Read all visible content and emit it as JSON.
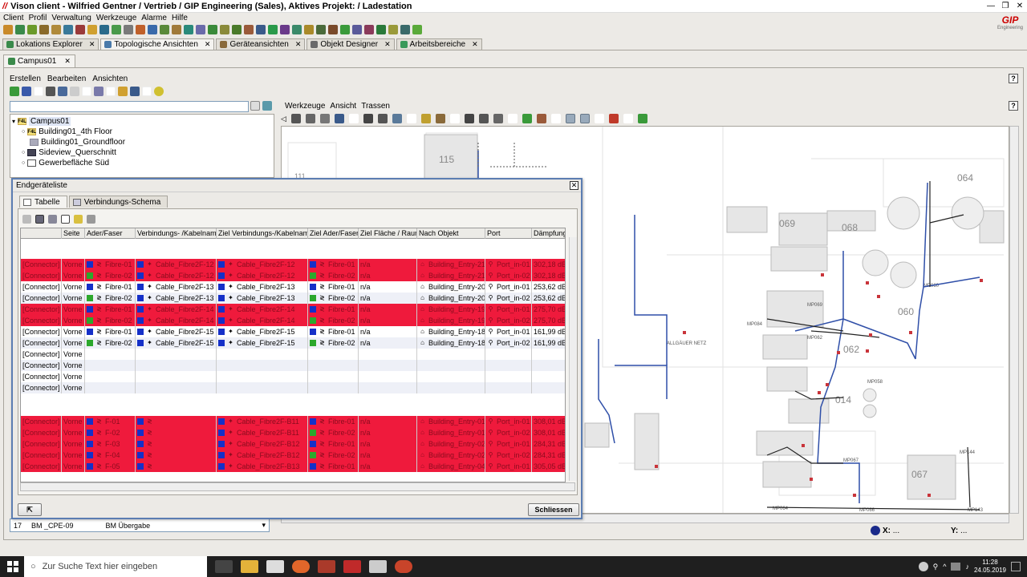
{
  "window": {
    "title": "Vison client - Wilfried Gentner / Vertrieb / GIP Engineering (Sales), Aktives Projekt: / Ladestation",
    "logo": "//",
    "brand": "GIP",
    "brand_sub": "Engineering"
  },
  "menu": [
    "Client",
    "Profil",
    "Verwaltung",
    "Werkzeuge",
    "Alarme",
    "Hilfe"
  ],
  "main_tabs": [
    {
      "label": "Lokations Explorer",
      "active": false
    },
    {
      "label": "Topologische Ansichten",
      "active": true
    },
    {
      "label": "Geräteansichten",
      "active": false
    },
    {
      "label": "Objekt Designer",
      "active": false
    },
    {
      "label": "Arbeitsbereiche",
      "active": false
    }
  ],
  "sub_tab": {
    "label": "Campus01"
  },
  "sub_menu": [
    "Erstellen",
    "Bearbeiten",
    "Ansichten"
  ],
  "tree": {
    "root": "Campus01",
    "items": [
      {
        "label": "Building01_4th Floor",
        "icon": "F4L"
      },
      {
        "label": "Building01_Groundfloor",
        "icon": "floor"
      },
      {
        "label": "Sideview_Querschnitt",
        "icon": "view"
      },
      {
        "label": "Gewerbefläche Süd",
        "icon": "area"
      }
    ]
  },
  "right_menu": [
    "Werkzeuge",
    "Ansicht",
    "Trassen"
  ],
  "map": {
    "labels": [
      "115",
      "111",
      "069",
      "068",
      "064",
      "062",
      "060",
      "067",
      "014",
      "ALLGÄUER NETZ",
      "MP144",
      "MP143",
      "MP064",
      "MP066",
      "MP067",
      "MP069",
      "MP084",
      "MP062",
      "MP060",
      "MP058"
    ]
  },
  "coords": {
    "x_label": "X:",
    "x_value": "...",
    "y_label": "Y:",
    "y_value": "..."
  },
  "bottom_row": {
    "num": "17",
    "name": "BM _CPE-09",
    "value": "BM Übergabe"
  },
  "dialog": {
    "title": "Endgeräteliste",
    "tabs": [
      {
        "label": "Tabelle",
        "active": true
      },
      {
        "label": "Verbindungs-Schema",
        "active": false
      }
    ],
    "columns": [
      "",
      "Seite",
      "Ader/Faser",
      "Verbindungs- /Kabelname",
      "Ziel Verbindungs-/Kabelname",
      "Ziel Ader/Faser",
      "Ziel Fläche / Raum",
      "Nach Objekt",
      "Port",
      "Dämpfung"
    ],
    "rows_a": [
      {
        "style": "red",
        "type": "[Connector]",
        "side": "Vorne",
        "fiber": "Fibre-01",
        "fc": "blue",
        "cable": "Cable_Fibre2F-12",
        "tcable": "Cable_Fibre2F-12",
        "tfiber": "Fibre-01",
        "tfc": "blue",
        "area": "n/a",
        "obj": "Building_Entry-21",
        "port": "Port_in-01",
        "damp": "302,18 dB"
      },
      {
        "style": "red",
        "type": "[Connector]",
        "side": "Vorne",
        "fiber": "Fibre-02",
        "fc": "green",
        "cable": "Cable_Fibre2F-12",
        "tcable": "Cable_Fibre2F-12",
        "tfiber": "Fibre-02",
        "tfc": "green",
        "area": "n/a",
        "obj": "Building_Entry-21",
        "port": "Port_in-02",
        "damp": "302,18 dB"
      },
      {
        "style": "white",
        "type": "[Connector]",
        "side": "Vorne",
        "fiber": "Fibre-01",
        "fc": "blue",
        "cable": "Cable_Fibre2F-13",
        "tcable": "Cable_Fibre2F-13",
        "tfiber": "Fibre-01",
        "tfc": "blue",
        "area": "n/a",
        "obj": "Building_Entry-20",
        "port": "Port_in-01",
        "damp": "253,62 dB"
      },
      {
        "style": "alt",
        "type": "[Connector]",
        "side": "Vorne",
        "fiber": "Fibre-02",
        "fc": "green",
        "cable": "Cable_Fibre2F-13",
        "tcable": "Cable_Fibre2F-13",
        "tfiber": "Fibre-02",
        "tfc": "green",
        "area": "n/a",
        "obj": "Building_Entry-20",
        "port": "Port_in-02",
        "damp": "253,62 dB"
      },
      {
        "style": "red",
        "type": "[Connector]",
        "side": "Vorne",
        "fiber": "Fibre-01",
        "fc": "blue",
        "cable": "Cable_Fibre2F-14",
        "tcable": "Cable_Fibre2F-14",
        "tfiber": "Fibre-01",
        "tfc": "blue",
        "area": "n/a",
        "obj": "Building_Entry-19",
        "port": "Port_in-01",
        "damp": "275,70 dB"
      },
      {
        "style": "red",
        "type": "[Connector]",
        "side": "Vorne",
        "fiber": "Fibre-02",
        "fc": "green",
        "cable": "Cable_Fibre2F-14",
        "tcable": "Cable_Fibre2F-14",
        "tfiber": "Fibre-02",
        "tfc": "green",
        "area": "n/a",
        "obj": "Building_Entry-19",
        "port": "Port_in-02",
        "damp": "275,70 dB"
      },
      {
        "style": "white",
        "type": "[Connector]",
        "side": "Vorne",
        "fiber": "Fibre-01",
        "fc": "blue",
        "cable": "Cable_Fibre2F-15",
        "tcable": "Cable_Fibre2F-15",
        "tfiber": "Fibre-01",
        "tfc": "blue",
        "area": "n/a",
        "obj": "Building_Entry-18",
        "port": "Port_in-01",
        "damp": "161,99 dB"
      },
      {
        "style": "alt",
        "type": "[Connector]",
        "side": "Vorne",
        "fiber": "Fibre-02",
        "fc": "green",
        "cable": "Cable_Fibre2F-15",
        "tcable": "Cable_Fibre2F-15",
        "tfiber": "Fibre-02",
        "tfc": "green",
        "area": "n/a",
        "obj": "Building_Entry-18",
        "port": "Port_in-02",
        "damp": "161,99 dB"
      },
      {
        "style": "white",
        "type": "[Connector]",
        "side": "Vorne"
      },
      {
        "style": "alt",
        "type": "[Connector]",
        "side": "Vorne"
      },
      {
        "style": "white",
        "type": "[Connector]",
        "side": "Vorne"
      },
      {
        "style": "alt",
        "type": "[Connector]",
        "side": "Vorne"
      }
    ],
    "rows_b": [
      {
        "style": "red",
        "type": "[Connector]",
        "side": "Vorne",
        "fiber": "F-01",
        "fc": "blue",
        "cable": "",
        "tcable": "Cable_Fibre2F-B11",
        "tfiber": "Fibre-01",
        "tfc": "blue",
        "area": "n/a",
        "obj": "Building_Entry-01",
        "port": "Port_in-01",
        "damp": "308,01 dB"
      },
      {
        "style": "red",
        "type": "[Connector]",
        "side": "Vorne",
        "fiber": "F-02",
        "fc": "blue",
        "cable": "",
        "tcable": "Cable_Fibre2F-B11",
        "tfiber": "Fibre-02",
        "tfc": "green",
        "area": "n/a",
        "obj": "Building_Entry-01",
        "port": "Port_in-02",
        "damp": "308,01 dB"
      },
      {
        "style": "red",
        "type": "[Connector]",
        "side": "Vorne",
        "fiber": "F-03",
        "fc": "blue",
        "cable": "",
        "tcable": "Cable_Fibre2F-B12",
        "tfiber": "Fibre-01",
        "tfc": "blue",
        "area": "n/a",
        "obj": "Building_Entry-02",
        "port": "Port_in-01",
        "damp": "284,31 dB"
      },
      {
        "style": "red",
        "type": "[Connector]",
        "side": "Vorne",
        "fiber": "F-04",
        "fc": "blue",
        "cable": "",
        "tcable": "Cable_Fibre2F-B12",
        "tfiber": "Fibre-02",
        "tfc": "green",
        "area": "n/a",
        "obj": "Building_Entry-02",
        "port": "Port_in-02",
        "damp": "284,31 dB"
      },
      {
        "style": "red",
        "type": "[Connector]",
        "side": "Vorne",
        "fiber": "F-05",
        "fc": "blue",
        "cable": "",
        "tcable": "Cable_Fibre2F-B13",
        "tfiber": "Fibre-01",
        "tfc": "blue",
        "area": "n/a",
        "obj": "Building_Entry-04",
        "port": "Port_in-01",
        "damp": "305,05 dB"
      }
    ],
    "close_button": "Schliessen"
  },
  "taskbar": {
    "search_placeholder": "Zur Suche Text hier eingeben",
    "time": "11:28",
    "date": "24.05.2019"
  },
  "colors": {
    "row_red": "#ef1a3c",
    "fiber_blue": "#1530c8",
    "fiber_green": "#2ca82c",
    "accent": "#5b7db2"
  }
}
